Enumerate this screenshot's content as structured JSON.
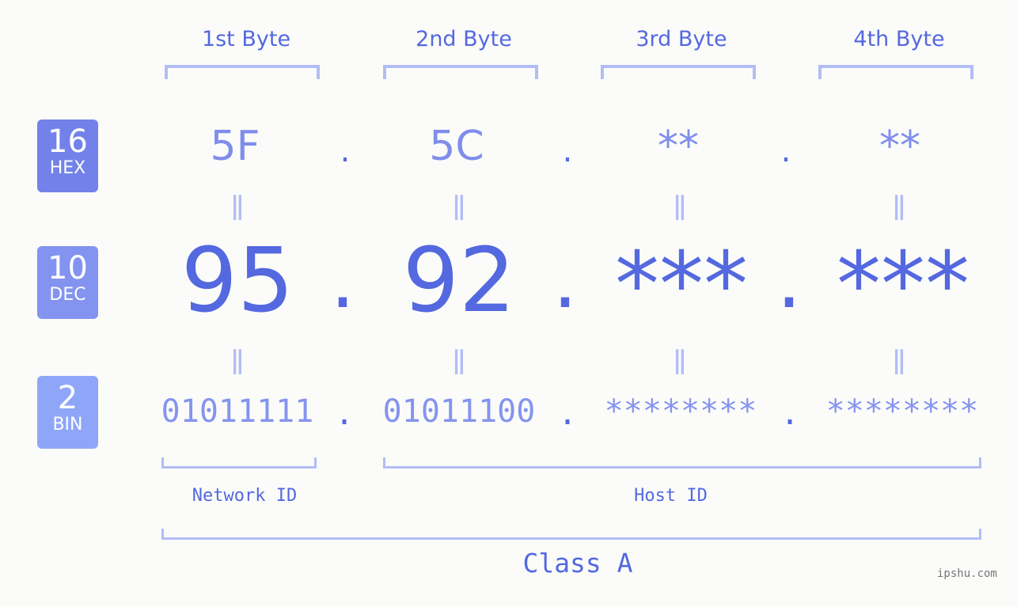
{
  "headers": [
    "1st Byte",
    "2nd Byte",
    "3rd Byte",
    "4th Byte"
  ],
  "badges": [
    {
      "num": "16",
      "label": "HEX",
      "color": "#7282ea"
    },
    {
      "num": "10",
      "label": "DEC",
      "color": "#8393f0"
    },
    {
      "num": "2",
      "label": "BIN",
      "color": "#8fa6f8"
    }
  ],
  "hex": [
    "5F",
    "5C",
    "**",
    "**"
  ],
  "dec": [
    "95",
    "92",
    "***",
    "***"
  ],
  "bin": [
    "01011111",
    "01011100",
    "********",
    "********"
  ],
  "separator": ".",
  "equals": "=",
  "network_label": "Network ID",
  "host_label": "Host ID",
  "class_label": "Class A",
  "watermark": "ipshu.com",
  "colors": {
    "accent": "#5468e0",
    "light": "#b3bdf5"
  }
}
